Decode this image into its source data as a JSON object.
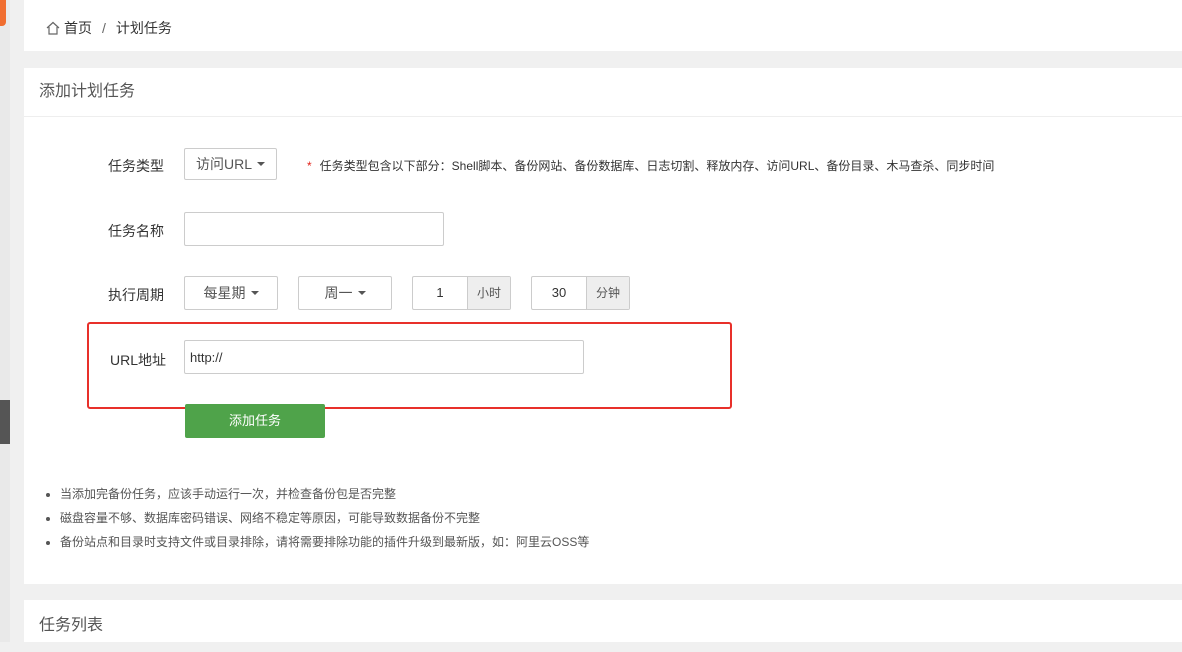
{
  "breadcrumb": {
    "home": "首页",
    "separator": "/",
    "current": "计划任务"
  },
  "add_panel": {
    "title": "添加计划任务",
    "task_type": {
      "label": "任务类型",
      "selected": "访问URL",
      "note_star": "*",
      "note": "任务类型包含以下部分：Shell脚本、备份网站、备份数据库、日志切割、释放内存、访问URL、备份目录、木马查杀、同步时间"
    },
    "task_name": {
      "label": "任务名称",
      "value": ""
    },
    "period": {
      "label": "执行周期",
      "cycle": "每星期",
      "weekday": "周一",
      "hour": "1",
      "hour_unit": "小时",
      "minute": "30",
      "minute_unit": "分钟"
    },
    "url": {
      "label": "URL地址",
      "value": "http://"
    },
    "submit_label": "添加任务",
    "tips": [
      "当添加完备份任务，应该手动运行一次，并检查备份包是否完整",
      "磁盘容量不够、数据库密码错误、网络不稳定等原因，可能导致数据备份不完整",
      "备份站点和目录时支持文件或目录排除，请将需要排除功能的插件升级到最新版，如：阿里云OSS等"
    ]
  },
  "list_panel": {
    "title": "任务列表"
  },
  "colors": {
    "accent_green": "#4fa34a",
    "highlight_red": "#e8302a",
    "required_star": "#e2231a"
  },
  "icons": {
    "home": "home-icon",
    "caret": "caret-down-icon"
  }
}
